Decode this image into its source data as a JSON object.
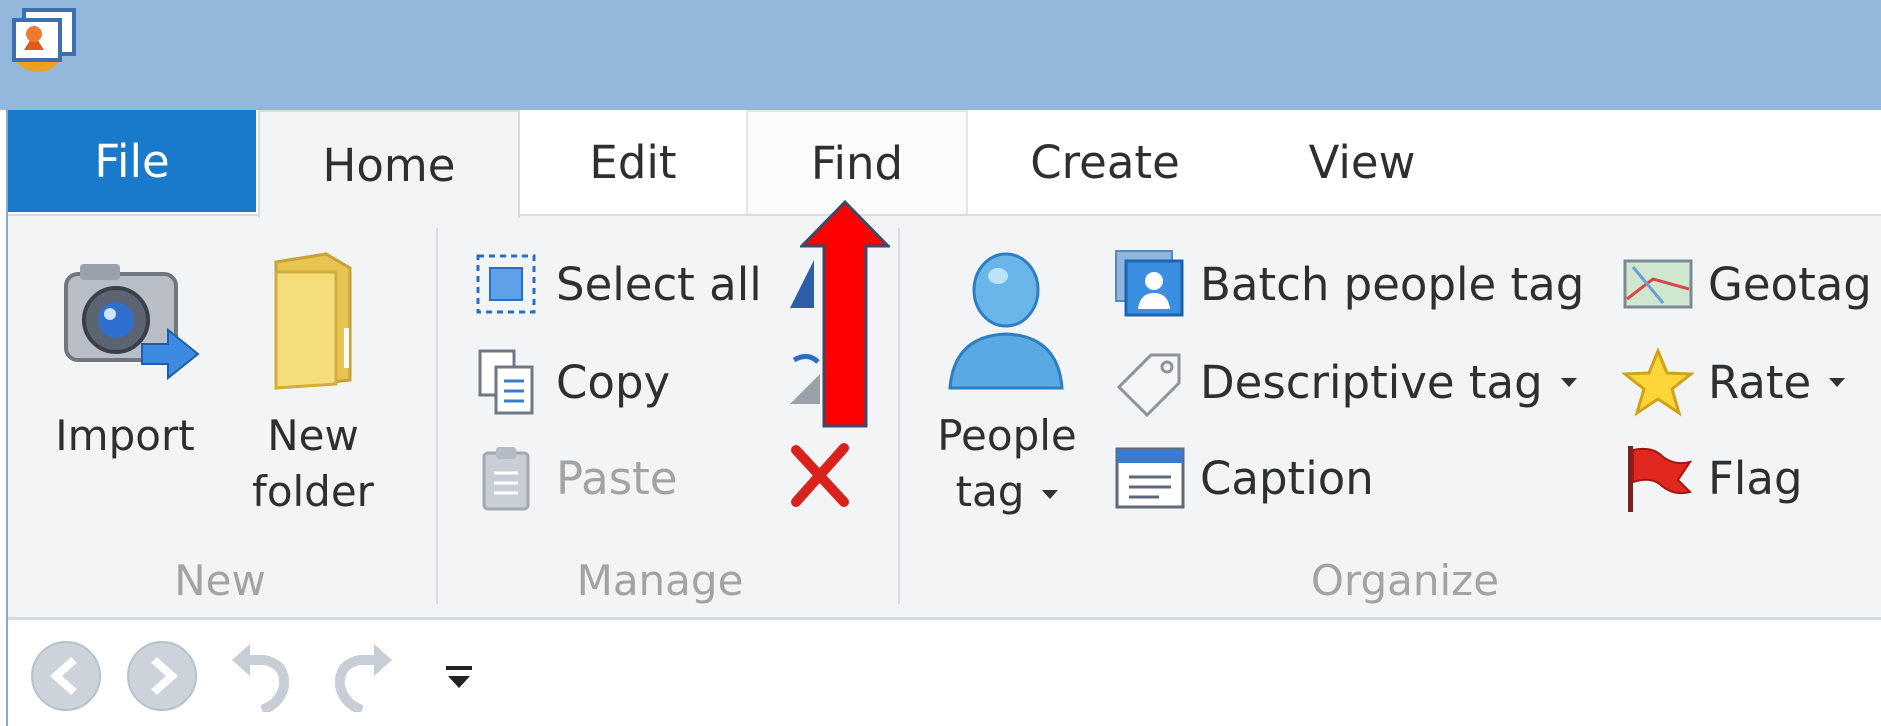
{
  "tabs": {
    "file": "File",
    "home": "Home",
    "edit": "Edit",
    "find": "Find",
    "create": "Create",
    "view": "View"
  },
  "groups": {
    "new": {
      "label": "New",
      "import": "Import",
      "new_folder_line1": "New",
      "new_folder_line2": "folder"
    },
    "manage": {
      "label": "Manage",
      "select_all": "Select all",
      "copy": "Copy",
      "paste": "Paste"
    },
    "organize": {
      "label": "Organize",
      "people_tag_line1": "People",
      "people_tag_line2": "tag",
      "batch_people_tag": "Batch people tag",
      "descriptive_tag": "Descriptive tag",
      "caption": "Caption",
      "geotag": "Geotag",
      "rate": "Rate",
      "flag": "Flag"
    }
  },
  "colors": {
    "titlebar": "#93b8dc",
    "file_tab": "#1979ca",
    "ribbon": "#f3f4f6",
    "annotation_arrow": "#ff0000"
  },
  "icons": {
    "app": "photo-gallery-icon",
    "import": "camera-import-icon",
    "new_folder": "folder-icon",
    "select_all": "select-all-icon",
    "copy": "copy-icon",
    "paste": "paste-icon",
    "delete": "delete-x-icon",
    "people_tag": "person-icon",
    "batch_people_tag": "batch-people-icon",
    "descriptive_tag": "tag-icon",
    "caption": "caption-icon",
    "geotag": "map-icon",
    "rate": "star-icon",
    "flag": "flag-icon"
  }
}
